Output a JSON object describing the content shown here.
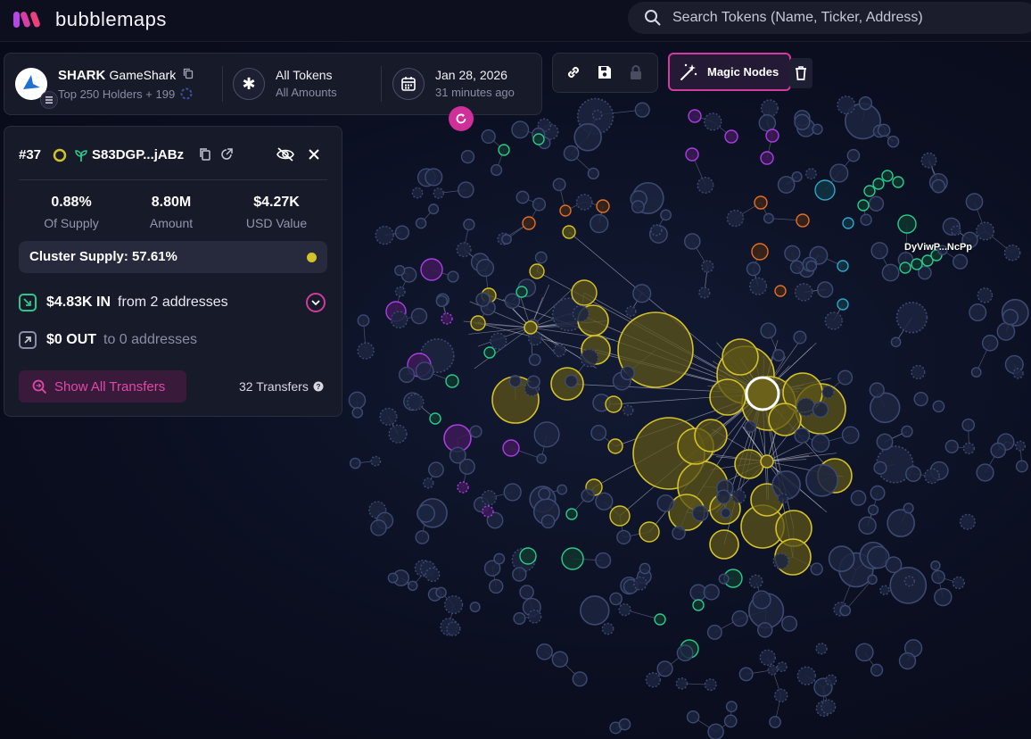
{
  "app": {
    "name": "bubblemaps"
  },
  "search": {
    "placeholder": "Search Tokens (Name, Ticker, Address)"
  },
  "token": {
    "ticker": "SHARK",
    "name": "GameShark",
    "holders_text": "Top 250 Holders + 199",
    "filter_title": "All Tokens",
    "filter_sub": "All Amounts",
    "date": "Jan 28, 2026",
    "updated": "31 minutes ago"
  },
  "toolbar": {
    "magic_label": "Magic Nodes"
  },
  "wallet": {
    "rank": "#37",
    "address": "S83DGP...jABz",
    "supply_value": "0.88%",
    "supply_label": "Of Supply",
    "amount_value": "8.80M",
    "amount_label": "Amount",
    "usd_value": "$4.27K",
    "usd_label": "USD Value",
    "cluster_supply": "Cluster Supply: 57.61%",
    "in_amount": "$4.83K IN",
    "in_text": "from 2 addresses",
    "out_amount": "$0 OUT",
    "out_text": "to 0 addresses",
    "show_transfers": "Show All Transfers",
    "transfer_count": "32 Transfers"
  },
  "graph": {
    "node_label": "DyViwP...NcPp",
    "colors": {
      "default": "#2a3352",
      "cluster": "#d4c22a",
      "purple": "#a93ee0",
      "green": "#2ac98a",
      "cyan": "#2aa6c6",
      "orange": "#e0702a",
      "accent": "#d13a9e"
    }
  }
}
